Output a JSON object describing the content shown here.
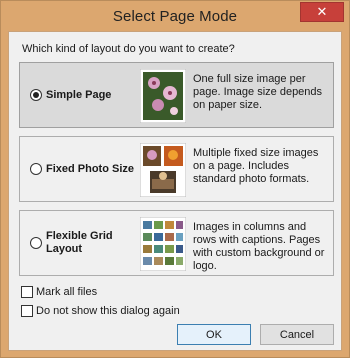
{
  "window": {
    "title": "Select Page Mode",
    "close_glyph": "✕"
  },
  "question": "Which kind of layout do you want to create?",
  "options": [
    {
      "label": "Simple Page",
      "selected": true,
      "description": "One full size image per page. Image size depends on paper size.",
      "icon": "single-photo-thumbnail"
    },
    {
      "label": "Fixed Photo Size",
      "selected": false,
      "description": "Multiple fixed size images on a page. Includes standard photo formats.",
      "icon": "fixed-photos-thumbnail"
    },
    {
      "label": "Flexible Grid Layout",
      "selected": false,
      "description": "Images in columns and rows with captions. Pages with custom background or logo.",
      "icon": "grid-thumbnail"
    }
  ],
  "checkboxes": {
    "mark_all": {
      "label": "Mark all files",
      "checked": false
    },
    "dont_show": {
      "label": "Do not show this dialog again",
      "checked": false
    }
  },
  "buttons": {
    "ok": "OK",
    "cancel": "Cancel"
  },
  "colors": {
    "title_bar": "#dca76f",
    "close_button": "#c7403a",
    "dialog_bg": "#f0f0f0",
    "selected_option_bg": "#dadada",
    "default_button_border": "#3c7fb1"
  }
}
